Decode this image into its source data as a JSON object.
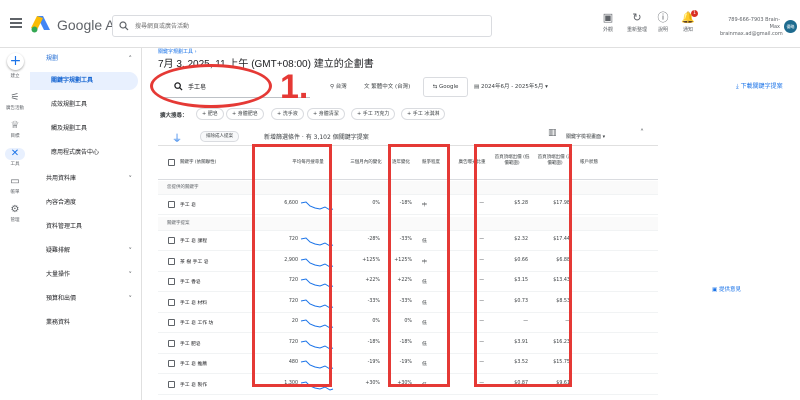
{
  "topbar": {
    "brand": "Google Ads",
    "search_placeholder": "搜尋網頁或廣告活動",
    "buttons": [
      {
        "label": "外觀",
        "icon": "appearance-icon"
      },
      {
        "label": "重新整理",
        "icon": "refresh-icon"
      },
      {
        "label": "說明",
        "icon": "help-icon"
      },
      {
        "label": "通知",
        "icon": "bell-icon",
        "badge": "1"
      }
    ],
    "account_line1": "789-666-7903 Brain-Max",
    "account_line2": "brainmax.ad@gmail.com",
    "avatar_text": "優略"
  },
  "rail": {
    "create": "建立",
    "items": [
      "廣告活動",
      "目標",
      "工具",
      "帳單",
      "管理"
    ]
  },
  "sidenav": {
    "section": "規劃",
    "items": [
      {
        "label": "關鍵字規劃工具",
        "active": true
      },
      {
        "label": "成效規劃工具"
      },
      {
        "label": "觸及規劃工具"
      },
      {
        "label": "應用程式廣告中心"
      }
    ],
    "groups": [
      {
        "label": "共用資料庫",
        "chevron": true
      },
      {
        "label": "內容合適度",
        "chevron": false
      },
      {
        "label": "資料管理工具",
        "chevron": false
      },
      {
        "label": "疑難排解",
        "chevron": true
      },
      {
        "label": "大量操作",
        "chevron": true
      },
      {
        "label": "預算和出價",
        "chevron": true
      },
      {
        "label": "業務資料",
        "chevron": false
      }
    ]
  },
  "main": {
    "breadcrumb": "關鍵字規劃工具 ›",
    "title": "7月 3, 2025, 11 上午 (GMT+08:00) 建立的企劃書",
    "keyword": "手工皂",
    "location": "台灣",
    "language": "繁體中文 (台灣)",
    "network": "Google",
    "date_range": "2024年6月 - 2025年5月",
    "download": "下載關鍵字提案",
    "expand_label": "擴大搜尋：",
    "expand_chips": [
      "+ 肥皂",
      "+ 身體肥皂",
      "+ 洗手液",
      "+ 身體清潔",
      "+ 手工 巧克力",
      "+ 手工 冰淇淋"
    ],
    "exclude_chip": "排除成人提案",
    "toolbar_text": "新增篩選條件 · 有 3,102 個關鍵字提案",
    "columns_btn": "欄",
    "view_select": "關鍵字檢視畫面",
    "feedback": "提供意見"
  },
  "table": {
    "headers": [
      "關鍵字 (依關聯性)",
      "平均每月搜尋量",
      "三個月內的變化",
      "逐年變化",
      "競爭程度",
      "廣告曝光比重",
      "首頁頂端出價 (低價範圍)",
      "首頁頂端出價 (高價範圍)",
      "帳戶狀態"
    ],
    "group_provided": "您提供的關鍵字",
    "group_ideas": "關鍵字提案",
    "provided": [
      {
        "kw": "手工 皂",
        "vol": "6,600",
        "m3": "0%",
        "yoy": "-18%",
        "comp": "中",
        "share": "—",
        "low": "$5.28",
        "high": "$17.98"
      }
    ],
    "ideas": [
      {
        "kw": "手工 皂 課程",
        "vol": "720",
        "m3": "-28%",
        "yoy": "-33%",
        "comp": "低",
        "share": "—",
        "low": "$2.32",
        "high": "$17.44"
      },
      {
        "kw": "茶 樹 手工 皂",
        "vol": "2,900",
        "m3": "+125%",
        "yoy": "+125%",
        "comp": "中",
        "share": "—",
        "low": "$0.66",
        "high": "$6.88"
      },
      {
        "kw": "手工 香皂",
        "vol": "720",
        "m3": "+22%",
        "yoy": "+22%",
        "comp": "低",
        "share": "—",
        "low": "$3.15",
        "high": "$13.43"
      },
      {
        "kw": "手工 皂 材料",
        "vol": "720",
        "m3": "-33%",
        "yoy": "-33%",
        "comp": "低",
        "share": "—",
        "low": "$0.73",
        "high": "$8.53"
      },
      {
        "kw": "手工 皂 工作 坊",
        "vol": "20",
        "m3": "0%",
        "yoy": "0%",
        "comp": "低",
        "share": "—",
        "low": "—",
        "high": "—"
      },
      {
        "kw": "手工 肥皂",
        "vol": "720",
        "m3": "-18%",
        "yoy": "-18%",
        "comp": "低",
        "share": "—",
        "low": "$3.91",
        "high": "$16.23"
      },
      {
        "kw": "手工 皂 推薦",
        "vol": "480",
        "m3": "-19%",
        "yoy": "-19%",
        "comp": "低",
        "share": "—",
        "low": "$3.52",
        "high": "$15.75"
      },
      {
        "kw": "手工 皂 製作",
        "vol": "1,300",
        "m3": "+30%",
        "yoy": "+30%",
        "comp": "低",
        "share": "—",
        "low": "$0.87",
        "high": "$9.61"
      },
      {
        "kw": "肥皂 製作",
        "vol": "1,300",
        "m3": "+46%",
        "yoy": "+46%",
        "comp": "低",
        "share": "—",
        "low": "$2.61",
        "high": "$9.70"
      }
    ]
  },
  "annotation": {
    "number": "1.",
    "color": "#e53935"
  },
  "colors": {
    "accent": "#1a73e8",
    "nav_active_bg": "#e8f0fe",
    "annotation_red": "#e53935"
  }
}
